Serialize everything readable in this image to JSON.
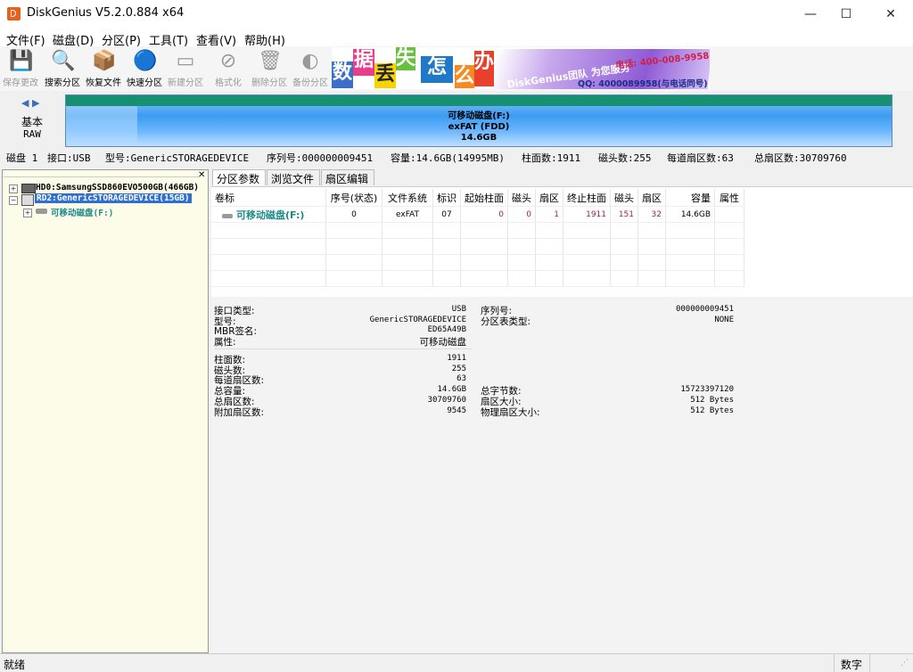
{
  "window": {
    "title": "DiskGenius V5.2.0.884 x64",
    "minimize": "—",
    "maximize": "☐",
    "close": "✕"
  },
  "menu": [
    "文件(F)",
    "磁盘(D)",
    "分区(P)",
    "工具(T)",
    "查看(V)",
    "帮助(H)"
  ],
  "toolbar": [
    {
      "label": "保存更改",
      "icon": "save-icon",
      "glyph": "💾",
      "enabled": false
    },
    {
      "label": "搜索分区",
      "icon": "magnifier-icon",
      "glyph": "🔍",
      "enabled": true
    },
    {
      "label": "恢复文件",
      "icon": "recover-icon",
      "glyph": "📦",
      "enabled": true
    },
    {
      "label": "快速分区",
      "icon": "quick-partition-icon",
      "glyph": "🔵",
      "enabled": true
    },
    {
      "label": "新建分区",
      "icon": "new-partition-icon",
      "glyph": "▭",
      "enabled": false
    },
    {
      "label": "格式化",
      "icon": "format-icon",
      "glyph": "⊘",
      "enabled": false
    },
    {
      "label": "删除分区",
      "icon": "trash-icon",
      "glyph": "🗑",
      "enabled": false
    },
    {
      "label": "备份分区",
      "icon": "backup-icon",
      "glyph": "◐",
      "enabled": false
    }
  ],
  "banner": {
    "chars": [
      "数",
      "据",
      "丢",
      "失",
      "怎",
      "么",
      "办"
    ],
    "team": "DiskGenius团队 为您服务",
    "phone": "电话: 400-008-9958",
    "qq": "QQ: 4000089958(与电话同号)"
  },
  "disk_panel": {
    "basic": "基本",
    "raw": "RAW",
    "partition_name": "可移动磁盘(F:)",
    "partition_fs": "exFAT (FDD)",
    "partition_size": "14.6GB"
  },
  "info_line": {
    "disk": "磁盘 1",
    "interface": "接口:USB",
    "model": "型号:GenericSTORAGEDEVICE",
    "serial": "序列号:000000009451",
    "capacity": "容量:14.6GB(14995MB)",
    "cylinders": "柱面数:1911",
    "heads": "磁头数:255",
    "sectors_per_track": "每道扇区数:63",
    "total_sectors": "总扇区数:30709760"
  },
  "tree": {
    "hd0": "HD0:SamsungSSD860EVO500GB(466GB)",
    "rd2": "RD2:GenericSTORAGEDEVICE(15GB)",
    "part": "可移动磁盘(F:)"
  },
  "tabs": [
    "分区参数",
    "浏览文件",
    "扇区编辑"
  ],
  "partition_table": {
    "headers": [
      "卷标",
      "序号(状态)",
      "文件系统",
      "标识",
      "起始柱面",
      "磁头",
      "扇区",
      "终止柱面",
      "磁头",
      "扇区",
      "容量",
      "属性"
    ],
    "rows": [
      [
        "可移动磁盘(F:)",
        "0",
        "exFAT",
        "07",
        "0",
        "0",
        "1",
        "1911",
        "151",
        "32",
        "14.6GB",
        ""
      ]
    ]
  },
  "details": {
    "interface_type_label": "接口类型:",
    "interface_type": "USB",
    "model_label": "型号:",
    "model": "GenericSTORAGEDEVICE",
    "mbr_sig_label": "MBR签名:",
    "mbr_sig": "ED65A49B",
    "attr_label": "属性:",
    "attr": "可移动磁盘",
    "serial_label": "序列号:",
    "serial": "000000009451",
    "pt_type_label": "分区表类型:",
    "pt_type": "NONE",
    "cyl_label": "柱面数:",
    "cyl": "1911",
    "heads_label": "磁头数:",
    "heads": "255",
    "spt_label": "每道扇区数:",
    "spt": "63",
    "total_cap_label": "总容量:",
    "total_cap": "14.6GB",
    "total_sec_label": "总扇区数:",
    "total_sec": "30709760",
    "extra_sec_label": "附加扇区数:",
    "extra_sec": "9545",
    "total_bytes_label": "总字节数:",
    "total_bytes": "15723397120",
    "sector_size_label": "扇区大小:",
    "sector_size": "512 Bytes",
    "phys_sector_label": "物理扇区大小:",
    "phys_sector": "512 Bytes"
  },
  "status": {
    "left": "就绪",
    "right": "数字"
  }
}
